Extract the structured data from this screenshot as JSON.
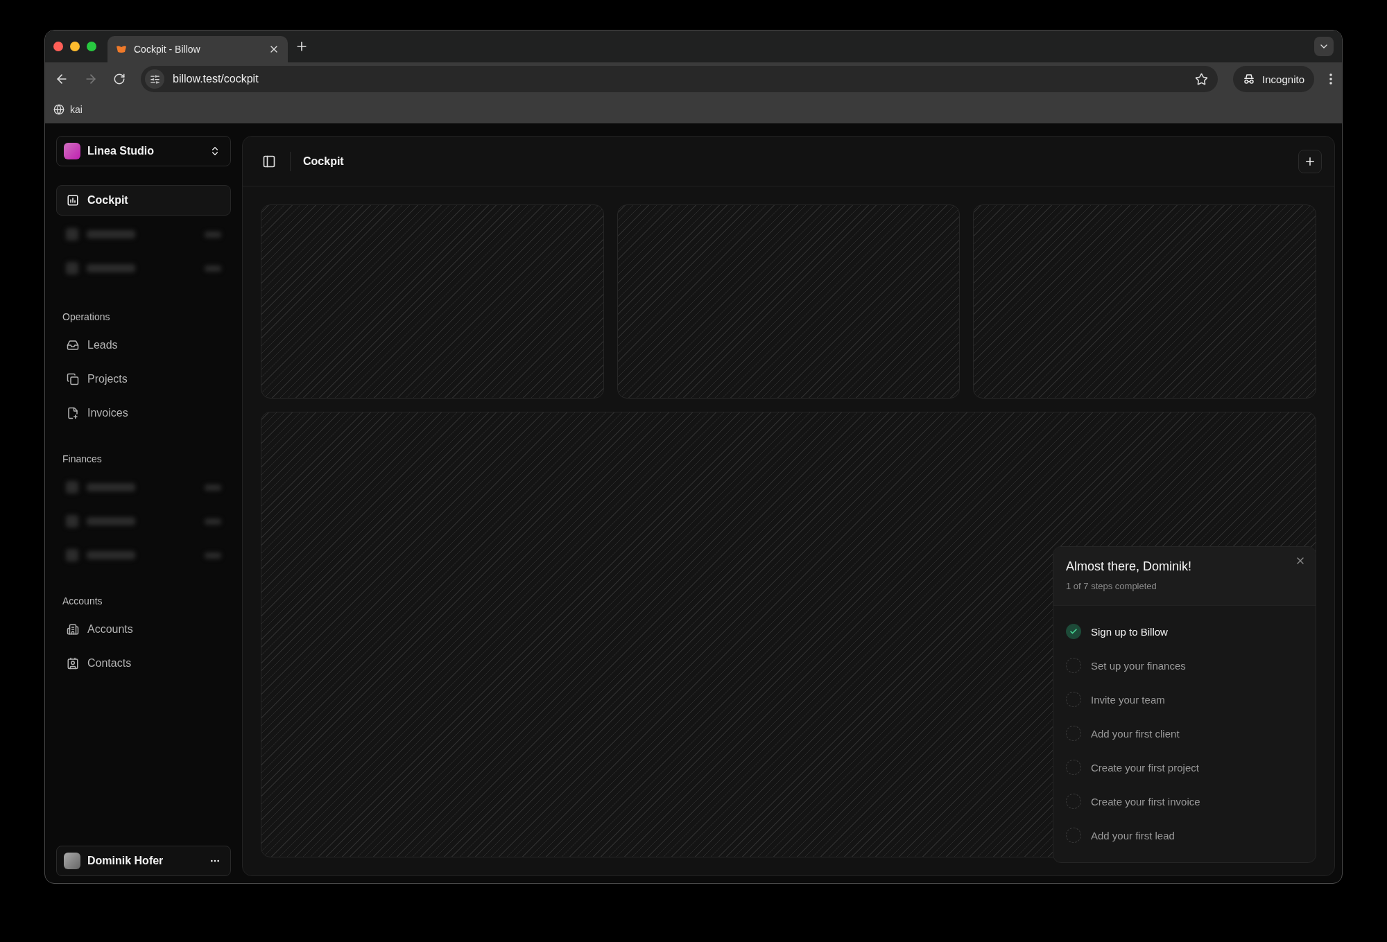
{
  "browser": {
    "tab": {
      "title": "Cockpit - Billow"
    },
    "url": "billow.test/cockpit",
    "profile": "Incognito",
    "bookmarks": [
      {
        "label": "kai"
      }
    ]
  },
  "sidebar": {
    "workspace": "Linea Studio",
    "top_items": [
      {
        "kind": "link",
        "label": "Cockpit",
        "selected": true
      },
      {
        "kind": "blurred"
      },
      {
        "kind": "blurred"
      }
    ],
    "sections": [
      {
        "title": "Operations",
        "items": [
          {
            "kind": "link",
            "label": "Leads",
            "selected": false
          },
          {
            "kind": "link",
            "label": "Projects",
            "selected": false
          },
          {
            "kind": "link",
            "label": "Invoices",
            "selected": false
          }
        ]
      },
      {
        "title": "Finances",
        "items": [
          {
            "kind": "blurred"
          },
          {
            "kind": "blurred"
          },
          {
            "kind": "blurred"
          }
        ]
      },
      {
        "title": "Accounts",
        "items": [
          {
            "kind": "link",
            "label": "Accounts",
            "selected": false
          },
          {
            "kind": "link",
            "label": "Contacts",
            "selected": false
          }
        ]
      }
    ],
    "user": "Dominik Hofer"
  },
  "header": {
    "title": "Cockpit"
  },
  "checklist": {
    "title": "Almost there, Dominik!",
    "subtitle": "1 of 7 steps completed",
    "steps": [
      {
        "label": "Sign up to Billow",
        "done": true
      },
      {
        "label": "Set up your finances",
        "done": false
      },
      {
        "label": "Invite your team",
        "done": false
      },
      {
        "label": "Add your first client",
        "done": false
      },
      {
        "label": "Create your first project",
        "done": false
      },
      {
        "label": "Create your first invoice",
        "done": false
      },
      {
        "label": "Add your first lead",
        "done": false
      }
    ]
  }
}
